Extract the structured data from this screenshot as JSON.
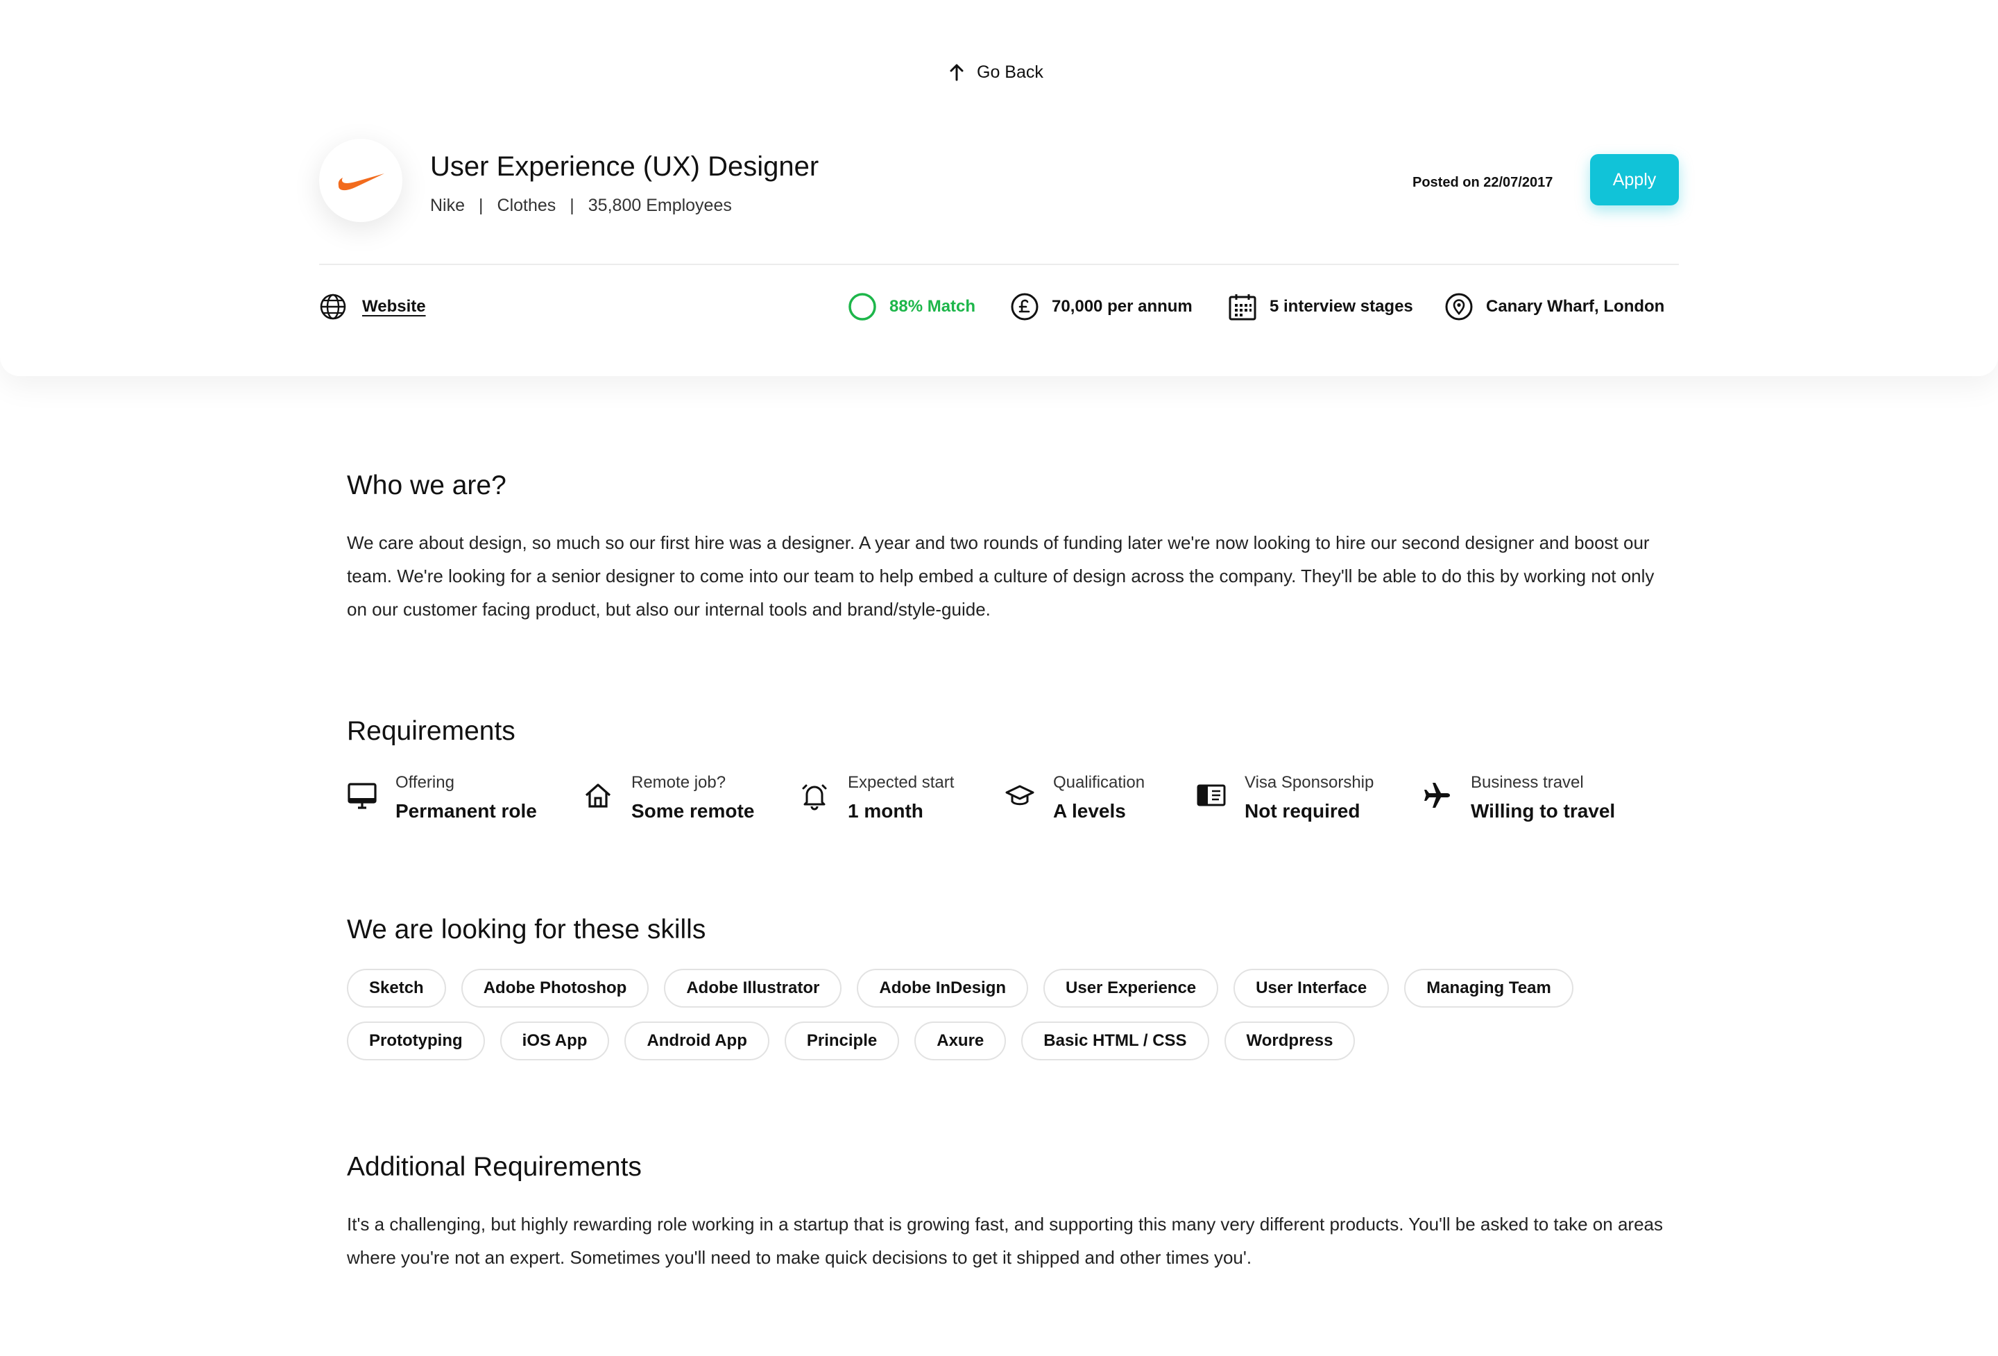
{
  "nav": {
    "go_back_label": "Go Back"
  },
  "job": {
    "title": "User Experience (UX) Designer",
    "company": "Nike",
    "industry": "Clothes",
    "employees": "35,800 Employees",
    "separator": "|",
    "posted": "Posted on 22/07/2017",
    "apply_label": "Apply",
    "website_label": "Website"
  },
  "meta": {
    "match": "88% Match",
    "salary": "70,000 per annum",
    "stages": "5 interview stages",
    "location": "Canary Wharf, London"
  },
  "colors": {
    "accent": "#11c3d8",
    "match_green": "#1db64a",
    "nike_orange": "#f26b1d"
  },
  "who": {
    "title": "Who we are?",
    "text": "We care about design, so much so our first hire was a designer. A year and two rounds of funding later we're now looking to hire our second designer and boost our team. We're looking for a senior designer to come into our team to help embed a culture of design across the company. They'll be able to do this by working not only on our customer facing product, but also our internal tools and brand/style-guide."
  },
  "requirements": {
    "title": "Requirements",
    "items": [
      {
        "label": "Offering",
        "value": "Permanent role",
        "icon": "monitor-icon"
      },
      {
        "label": "Remote job?",
        "value": "Some remote",
        "icon": "home-icon"
      },
      {
        "label": "Expected start",
        "value": "1 month",
        "icon": "bell-icon"
      },
      {
        "label": "Qualification",
        "value": "A levels",
        "icon": "graduation-cap-icon"
      },
      {
        "label": "Visa Sponsorship",
        "value": "Not required",
        "icon": "passport-icon"
      },
      {
        "label": "Business travel",
        "value": "Willing to travel",
        "icon": "airplane-icon"
      }
    ]
  },
  "skills": {
    "title": "We are looking for these skills",
    "row1": [
      "Sketch",
      "Adobe Photoshop",
      "Adobe Illustrator",
      "Adobe InDesign",
      "User Experience",
      "User Interface",
      "Managing Team"
    ],
    "row2": [
      "Prototyping",
      "iOS App",
      "Android App",
      "Principle",
      "Axure",
      "Basic HTML / CSS",
      "Wordpress"
    ]
  },
  "additional": {
    "title": "Additional Requirements",
    "text": "It's a challenging, but highly rewarding role working in a startup that is growing fast, and supporting this many very different products. You'll be asked to take on areas where you're not an expert. Sometimes you'll need to make quick decisions to get it shipped and other times you'."
  }
}
